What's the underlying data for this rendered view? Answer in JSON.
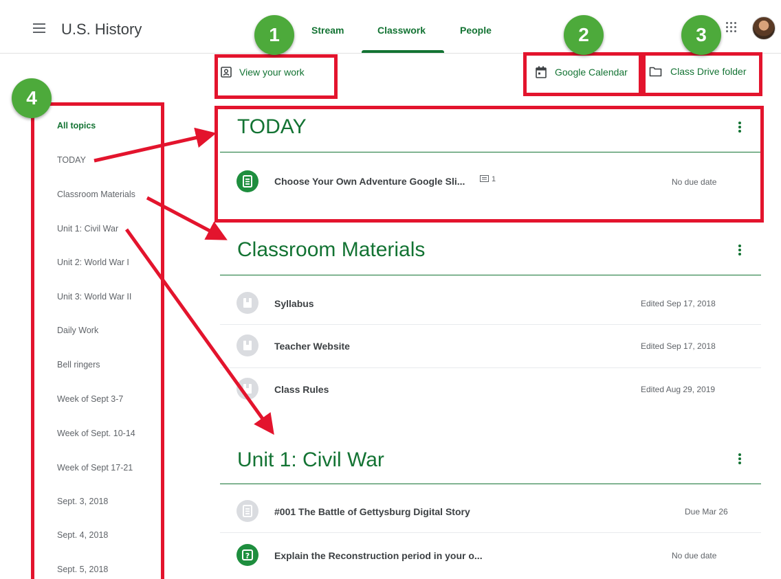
{
  "header": {
    "class_name": "U.S. History",
    "tabs": [
      {
        "label": "Stream"
      },
      {
        "label": "Classwork",
        "active": true
      },
      {
        "label": "People"
      }
    ]
  },
  "toolbar": {
    "view_work": "View your work",
    "calendar": "Google Calendar",
    "drive": "Class Drive folder"
  },
  "sidebar": {
    "items": [
      {
        "label": "All topics",
        "active": true
      },
      {
        "label": "TODAY"
      },
      {
        "label": "Classroom Materials"
      },
      {
        "label": "Unit 1: Civil War"
      },
      {
        "label": "Unit 2: World War I"
      },
      {
        "label": "Unit 3: World War II"
      },
      {
        "label": "Daily Work"
      },
      {
        "label": "Bell ringers"
      },
      {
        "label": "Week of Sept 3-7"
      },
      {
        "label": "Week of Sept. 10-14"
      },
      {
        "label": "Week of Sept 17-21"
      },
      {
        "label": "Sept. 3, 2018"
      },
      {
        "label": "Sept. 4, 2018"
      },
      {
        "label": "Sept. 5, 2018"
      }
    ]
  },
  "topics": [
    {
      "title": "TODAY",
      "items": [
        {
          "title": "Choose Your Own Adventure Google Sli...",
          "comments": "1",
          "meta": "No due date",
          "icon": "assignment-icon"
        }
      ]
    },
    {
      "title": "Classroom Materials",
      "items": [
        {
          "title": "Syllabus",
          "meta": "Edited Sep 17, 2018",
          "icon": "material-icon"
        },
        {
          "title": "Teacher Website",
          "meta": "Edited Sep 17, 2018",
          "icon": "material-icon"
        },
        {
          "title": "Class Rules",
          "meta": "Edited Aug 29, 2019",
          "icon": "material-icon"
        }
      ]
    },
    {
      "title": "Unit 1: Civil War",
      "items": [
        {
          "title": "#001 The Battle of Gettysburg Digital Story",
          "meta": "Due Mar 26",
          "icon": "assignment-icon"
        },
        {
          "title": "Explain the Reconstruction period in your o...",
          "meta": "No due date",
          "icon": "question-icon"
        }
      ]
    }
  ],
  "annotations": {
    "badges": [
      "1",
      "2",
      "3",
      "4"
    ],
    "colors": {
      "box": "#e3142d",
      "badge": "#4daa3b",
      "accent": "#137333"
    }
  }
}
